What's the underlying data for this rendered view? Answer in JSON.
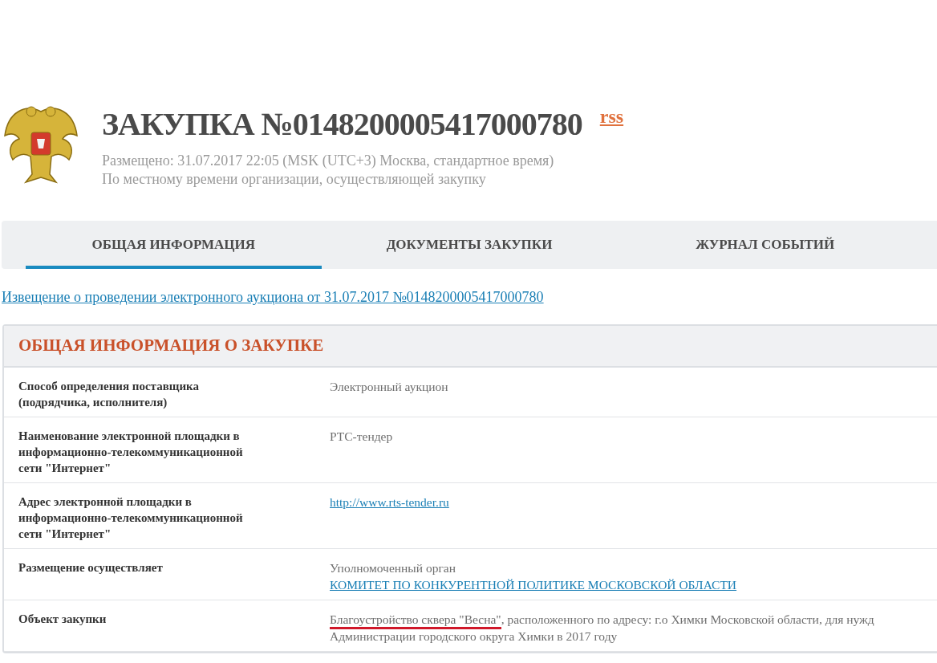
{
  "header": {
    "title": "ЗАКУПКА №0148200005417000780",
    "rss_link": "rss",
    "posted": "Размещено: 31.07.2017 22:05 (MSK (UTC+3) Москва, стандартное время)",
    "time_note": "По местному времени организации, осуществляющей закупку"
  },
  "tabs": [
    {
      "label": "ОБЩАЯ ИНФОРМАЦИЯ",
      "selected": true
    },
    {
      "label": "ДОКУМЕНТЫ ЗАКУПКИ",
      "selected": false
    },
    {
      "label": "ЖУРНАЛ СОБЫТИЙ",
      "selected": false
    }
  ],
  "notice_link": "Извещение о проведении электронного аукциона от 31.07.2017 №0148200005417000780 ",
  "section": {
    "title": "ОБЩАЯ ИНФОРМАЦИЯ О ЗАКУПКЕ",
    "rows": [
      {
        "label": "Способ определения поставщика (подрядчика, исполнителя)",
        "value": [
          [
            {
              "kind": "text",
              "text": "Электронный аукцион",
              "marked": false
            }
          ]
        ]
      },
      {
        "label": "Наименование электронной площадки в информационно-телекоммуникационной сети \"Интернет\"",
        "value": [
          [
            {
              "kind": "text",
              "text": "РТС-тендер",
              "marked": false
            }
          ]
        ]
      },
      {
        "label": "Адрес электронной площадки в информационно-телекоммуникационной сети \"Интернет\"",
        "value": [
          [
            {
              "kind": "link",
              "text": "http://www.rts-tender.ru",
              "marked": false
            }
          ]
        ]
      },
      {
        "label": "Размещение осуществляет",
        "value": [
          [
            {
              "kind": "text",
              "text": "Уполномоченный орган",
              "marked": false
            }
          ],
          [
            {
              "kind": "link",
              "text": "КОМИТЕТ ПО КОНКУРЕНТНОЙ ПОЛИТИКЕ МОСКОВСКОЙ ОБЛАСТИ",
              "marked": false
            }
          ]
        ]
      },
      {
        "label": "Объект закупки",
        "value": [
          [
            {
              "kind": "text",
              "text": "Благоустройство сквера \"Весна\"",
              "marked": true
            },
            {
              "kind": "text",
              "text": ", расположенного по адресу: г.о Химки Московской области, для нужд Администрации городского округа Химки в 2017 году",
              "marked": false
            }
          ]
        ]
      }
    ]
  }
}
